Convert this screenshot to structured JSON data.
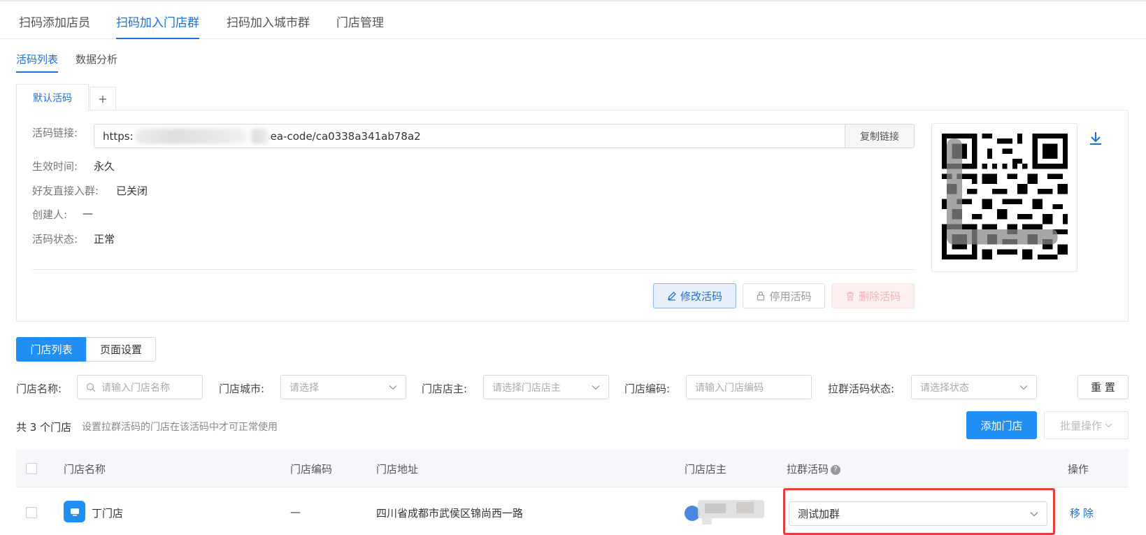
{
  "top_tabs": [
    "扫码添加店员",
    "扫码加入门店群",
    "扫码加入城市群",
    "门店管理"
  ],
  "sub_tabs": [
    "活码列表",
    "数据分析"
  ],
  "code_tabs": {
    "active": "默认活码",
    "add": "+"
  },
  "detail": {
    "link_label": "活码链接:",
    "link_prefix": "https:",
    "link_suffix": "ea-code/ca0338a341ab78a2",
    "copy_label": "复制链接",
    "effective_label": "生效时间:",
    "effective_value": "永久",
    "direct_join_label": "好友直接入群:",
    "direct_join_value": "已关闭",
    "creator_label": "创建人:",
    "creator_value": "—",
    "status_label": "活码状态:",
    "status_value": "正常"
  },
  "actions": {
    "edit": "修改活码",
    "stop": "停用活码",
    "delete": "删除活码"
  },
  "store_tabs": {
    "active": "门店列表",
    "inactive": "页面设置"
  },
  "filters": {
    "name_label": "门店名称:",
    "name_placeholder": "请输入门店名称",
    "city_label": "门店城市:",
    "city_placeholder": "请选择",
    "owner_label": "门店店主:",
    "owner_placeholder": "请选择门店店主",
    "code_label": "门店编码:",
    "code_placeholder": "请输入门店编码",
    "status_label": "拉群活码状态:",
    "status_placeholder": "请选择状态",
    "reset": "重 置"
  },
  "list_header": {
    "count": "共 3 个门店",
    "hint": "设置拉群活码的门店在该活码中才可正常使用",
    "add_store": "添加门店",
    "batch": "批量操作"
  },
  "table": {
    "columns": [
      "门店名称",
      "门店编码",
      "门店地址",
      "门店店主",
      "拉群活码",
      "操作"
    ],
    "rows": [
      {
        "name": "丁门店",
        "code": "—",
        "address": "四川省成都市武侯区锦尚西一路",
        "group_code": "测试加群",
        "action": "移除"
      }
    ]
  },
  "colors": {
    "primary": "#1f8ff4",
    "link": "#1e6fd9",
    "highlight": "#e63e3e"
  }
}
